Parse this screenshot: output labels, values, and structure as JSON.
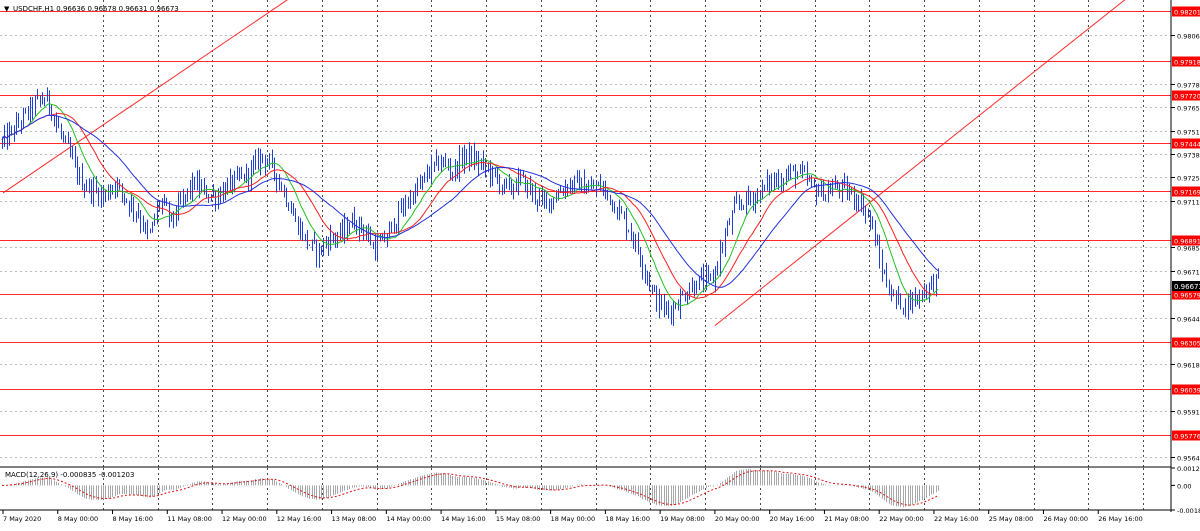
{
  "header": {
    "caret": "▼",
    "title": "USDCHF,H1 0.96636 0.96678 0.96631 0.96673"
  },
  "macd": {
    "title": "MACD(12,26,9) -0.000835 -0.001203",
    "ticks": [
      "0.00128",
      "0.00",
      "-0.00181"
    ]
  },
  "price_axis": {
    "ticks": [
      "0.98065",
      "0.97785",
      "0.97650",
      "0.97515",
      "0.97385",
      "0.97250",
      "0.97115",
      "0.96850",
      "0.96715",
      "0.96445",
      "0.96180",
      "0.95910",
      "0.95645"
    ]
  },
  "levels": [
    {
      "label": "0.98201"
    },
    {
      "label": "0.97918"
    },
    {
      "label": "0.97720"
    },
    {
      "label": "0.97444"
    },
    {
      "label": "0.97169"
    },
    {
      "label": "0.96891"
    },
    {
      "label": "0.96579"
    },
    {
      "label": "0.96305"
    },
    {
      "label": "0.96039"
    },
    {
      "label": "0.95776"
    }
  ],
  "current_price": "0.96673",
  "time_axis": [
    "7 May 2020",
    "8 May 00:00",
    "8 May 16:00",
    "11 May 08:00",
    "12 May 00:00",
    "12 May 16:00",
    "13 May 08:00",
    "14 May 00:00",
    "14 May 16:00",
    "15 May 08:00",
    "18 May 00:00",
    "18 May 16:00",
    "19 May 08:00",
    "20 May 00:00",
    "20 May 16:00",
    "21 May 08:00",
    "22 May 00:00",
    "22 May 16:00",
    "25 May 08:00",
    "26 May 00:00",
    "26 May 16:00"
  ],
  "colors": {
    "level_line": "#ff2a2a",
    "level_label_bg": "#ff0000",
    "candles": "#1f3fd8",
    "ma_fast": "#22c022",
    "ma_mid": "#ff2020",
    "ma_slow": "#2030e0",
    "signal": "#e01010",
    "histogram": "#a8a8a8",
    "current_label_bg": "#000000"
  },
  "chart_data": {
    "type": "candlestick",
    "symbol": "USDCHF",
    "timeframe": "H1",
    "last_quote": {
      "open": 0.96636,
      "high": 0.96678,
      "low": 0.96631,
      "close": 0.96673
    },
    "horizontal_levels": [
      0.98201,
      0.97918,
      0.9772,
      0.97444,
      0.97169,
      0.96891,
      0.96579,
      0.96305,
      0.96039,
      0.95776
    ],
    "price_path": [
      0.9745,
      0.9752,
      0.976,
      0.9768,
      0.977,
      0.9752,
      0.9738,
      0.9722,
      0.9718,
      0.9714,
      0.9722,
      0.9712,
      0.9705,
      0.969,
      0.9712,
      0.97,
      0.9712,
      0.9722,
      0.9716,
      0.9714,
      0.972,
      0.9724,
      0.9728,
      0.9738,
      0.973,
      0.9716,
      0.97,
      0.9688,
      0.9682,
      0.969,
      0.9692,
      0.97,
      0.9696,
      0.9684,
      0.969,
      0.9702,
      0.9712,
      0.972,
      0.973,
      0.9734,
      0.9728,
      0.9738,
      0.9734,
      0.973,
      0.9722,
      0.9718,
      0.9724,
      0.9716,
      0.971,
      0.9714,
      0.972,
      0.9722,
      0.9718,
      0.972,
      0.9712,
      0.9702,
      0.969,
      0.9672,
      0.9654,
      0.9648,
      0.9654,
      0.9662,
      0.9666,
      0.9666,
      0.969,
      0.9708,
      0.9712,
      0.9715,
      0.9722,
      0.9724,
      0.9728,
      0.9726,
      0.9718,
      0.9716,
      0.972,
      0.9716,
      0.9712,
      0.97,
      0.9672,
      0.9656,
      0.9652,
      0.9656,
      0.9662,
      0.9667
    ],
    "series": [
      {
        "name": "MA fast"
      },
      {
        "name": "MA mid"
      },
      {
        "name": "MA slow"
      }
    ],
    "trendlines": [
      {
        "from": [
          "7 May 2020",
          0.9716
        ],
        "to": [
          "12 May 16:00",
          0.984
        ]
      },
      {
        "from": [
          "20 May 00:00",
          0.964
        ],
        "to": [
          "26 May 16:00",
          0.9835
        ]
      }
    ],
    "y_range": [
      0.9559,
      0.98265
    ],
    "macd_range": [
      -0.00181,
      0.00128
    ],
    "grid": true
  }
}
